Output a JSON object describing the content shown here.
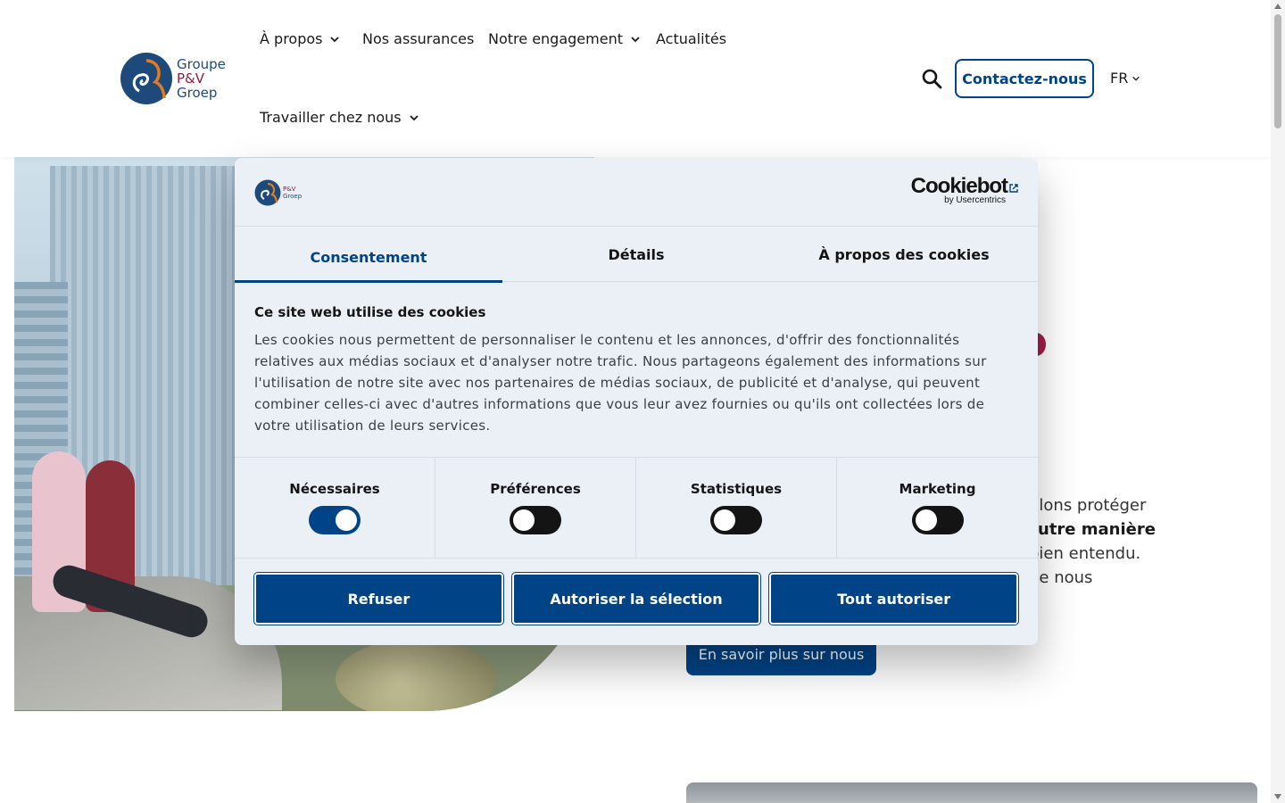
{
  "header": {
    "logo_lines": [
      "Groupe",
      "P&V",
      "Groep"
    ],
    "nav": [
      {
        "label": "À propos",
        "has_dropdown": true
      },
      {
        "label": "Nos assurances",
        "has_dropdown": false
      },
      {
        "label": "Notre engagement",
        "has_dropdown": true
      },
      {
        "label": "Actualités",
        "has_dropdown": false
      },
      {
        "label": "Travailler chez nous",
        "has_dropdown": true
      }
    ],
    "search_icon": "search-icon",
    "contact_label": "Contactez-nous",
    "language": "FR"
  },
  "hero": {
    "text_line1": "ulons protéger",
    "text_line2": "utre manière",
    "text_line3": "bien entendu.",
    "text_line4": "ue nous",
    "button_label": "En savoir plus sur nous"
  },
  "cookie_dialog": {
    "logo_lines": [
      "P&V",
      "Groep"
    ],
    "brand": "Cookiebot",
    "brand_sub": "by Usercentrics",
    "tabs": [
      {
        "label": "Consentement",
        "active": true
      },
      {
        "label": "Détails",
        "active": false
      },
      {
        "label": "À propos des cookies",
        "active": false
      }
    ],
    "title": "Ce site web utilise des cookies",
    "text": "Les cookies nous permettent de personnaliser le contenu et les annonces, d'offrir des fonctionnalités relatives aux médias sociaux et d'analyser notre trafic. Nous partageons également des informations sur l'utilisation de notre site avec nos partenaires de médias sociaux, de publicité et d'analyse, qui peuvent combiner celles-ci avec d'autres informations que vous leur avez fournies ou qu'ils ont collectées lors de votre utilisation de leurs services.",
    "toggles": [
      {
        "label": "Nécessaires",
        "on": true
      },
      {
        "label": "Préférences",
        "on": false
      },
      {
        "label": "Statistiques",
        "on": false
      },
      {
        "label": "Marketing",
        "on": false
      }
    ],
    "buttons": [
      "Refuser",
      "Autoriser la sélection",
      "Tout autoriser"
    ]
  },
  "colors": {
    "primary": "#004487",
    "accent": "#a01c4a",
    "dialog_bg": "#ebf0f6"
  }
}
